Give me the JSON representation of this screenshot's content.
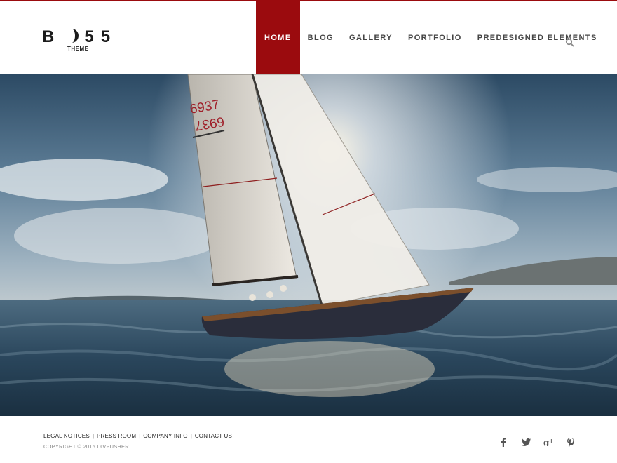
{
  "brand": {
    "logo_text": "B 5 5",
    "logo_sub": "THEME",
    "accent_color": "#9b0b0e"
  },
  "nav": {
    "items": [
      {
        "label": "HOME",
        "active": true
      },
      {
        "label": "BLOG",
        "active": false
      },
      {
        "label": "GALLERY",
        "active": false
      },
      {
        "label": "PORTFOLIO",
        "active": false
      },
      {
        "label": "PREDESIGNED ELEMENTS",
        "active": false
      }
    ],
    "search_icon": "search-icon"
  },
  "hero": {
    "sail_number_1": "6937",
    "sail_number_2": "6937"
  },
  "footer": {
    "links": [
      "LEGAL NOTICES",
      "PRESS ROOM",
      "COMPANY INFO",
      "CONTACT US"
    ],
    "copyright": "COPYRIGHT © 2015 DIVPUSHER",
    "social": [
      {
        "name": "facebook-icon",
        "glyph": "f"
      },
      {
        "name": "twitter-icon",
        "glyph": "ᴛ"
      },
      {
        "name": "google-plus-icon",
        "glyph": "g+"
      },
      {
        "name": "pinterest-icon",
        "glyph": "p"
      }
    ]
  }
}
